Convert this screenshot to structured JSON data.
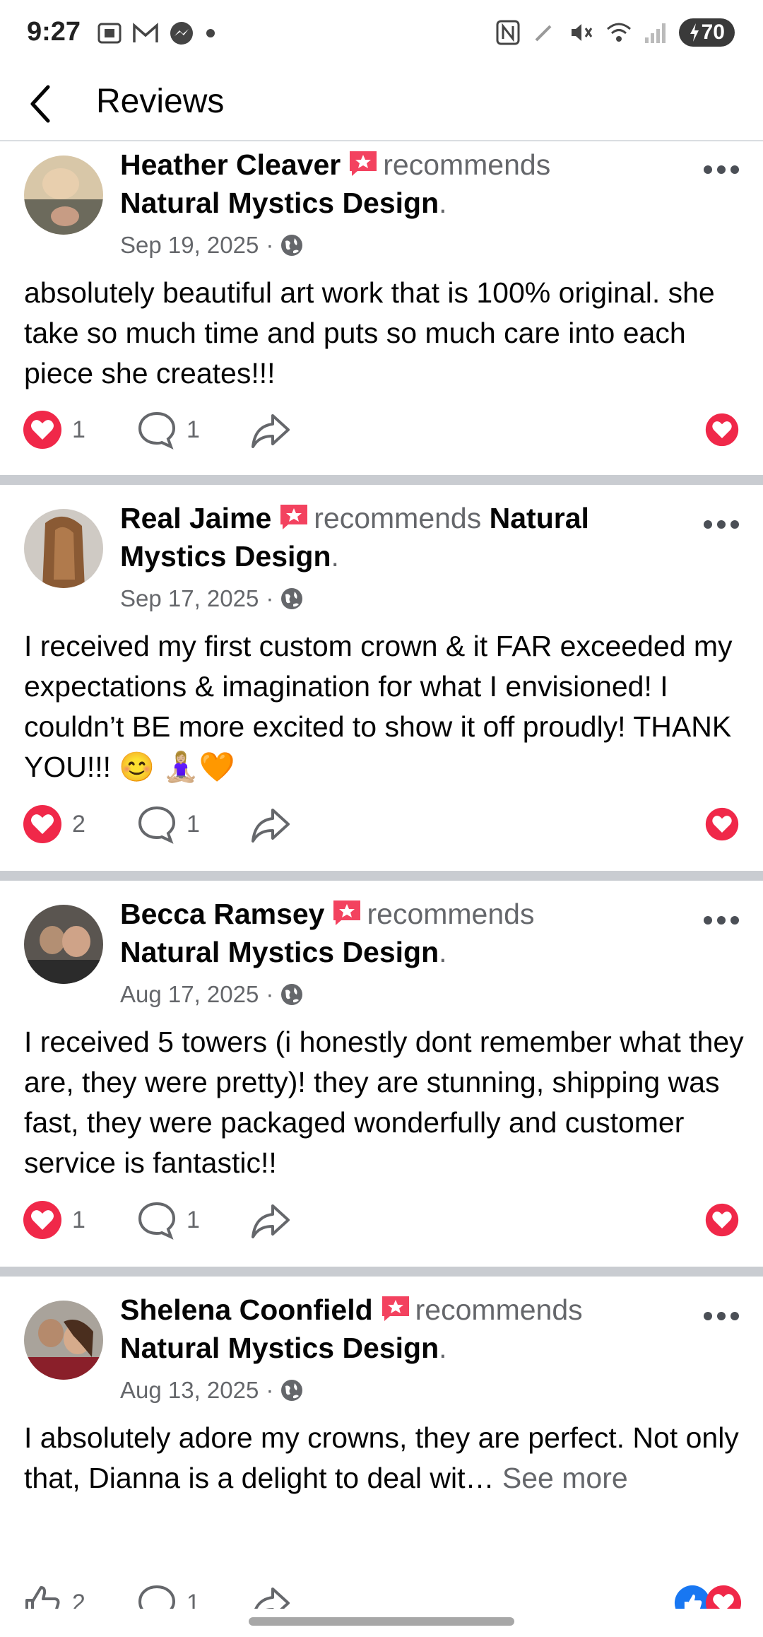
{
  "status_bar": {
    "time": "9:27",
    "battery": "70"
  },
  "header": {
    "title": "Reviews"
  },
  "reviews": [
    {
      "author": "Heather Cleaver",
      "verb": "recommends",
      "page": "Natural Mystics Design",
      "date": "Sep 19, 2025",
      "text": "absolutely beautiful art work that is 100% original. she take so much time and puts so much care into each piece she creates!!!",
      "reactions": "1",
      "comments": "1"
    },
    {
      "author": "Real Jaime",
      "verb": "recommends",
      "page": "Natural Mystics Design",
      "date": "Sep 17, 2025",
      "text": "I received my first custom crown & it FAR exceeded my expectations & imagination for what I envisioned! I couldn’t BE more excited to show it off proudly! THANK YOU!!! 😊 🧘🏼‍♀️🧡",
      "reactions": "2",
      "comments": "1"
    },
    {
      "author": "Becca Ramsey",
      "verb": "recommends",
      "page": "Natural Mystics Design",
      "date": "Aug 17, 2025",
      "text": "I received 5 towers (i honestly dont remember what they are, they were pretty)! they are stunning, shipping was fast, they were packaged wonderfully and customer service is fantastic!!",
      "reactions": "1",
      "comments": "1"
    },
    {
      "author": "Shelena Coonfield",
      "verb": "recommends",
      "page": "Natural Mystics Design",
      "date": "Aug 13, 2025",
      "text": "I absolutely adore my crowns, they are perfect. Not only that, Dianna is a delight to deal wit…",
      "see_more": "See more",
      "reactions": "2",
      "comments": "1"
    }
  ],
  "colors": {
    "heart_red": "#f02849",
    "like_blue": "#1877f2",
    "separator": "#c9ccd1"
  },
  "icons": [
    "back-arrow-icon",
    "recommend-badge-icon",
    "globe-icon",
    "heart-icon",
    "comment-icon",
    "share-icon",
    "like-icon",
    "more-icon"
  ]
}
